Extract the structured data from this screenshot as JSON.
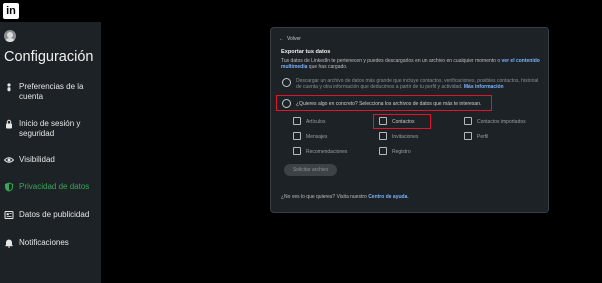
{
  "app": {
    "logo_text": "in"
  },
  "sidebar": {
    "title": "Configuración",
    "items": [
      {
        "label": "Preferencias de la cuenta",
        "icon": "person-icon",
        "active": false
      },
      {
        "label": "Inicio de sesión y seguridad",
        "icon": "lock-icon",
        "active": false
      },
      {
        "label": "Visibilidad",
        "icon": "eye-icon",
        "active": false
      },
      {
        "label": "Privacidad de datos",
        "icon": "shield-icon",
        "active": true
      },
      {
        "label": "Datos de publicidad",
        "icon": "newspaper-icon",
        "active": false
      },
      {
        "label": "Notificaciones",
        "icon": "bell-icon",
        "active": false
      }
    ]
  },
  "panel": {
    "back_label": "Volver",
    "heading": "Exportar tus datos",
    "description": "Tus datos de LinkedIn te pertenecen y puedes descargarlos en un archivo en cualquier momento o",
    "description_link": "ver el contenido multimedia",
    "description_tail": "que has cargado.",
    "option_all_text": "Descargar un archivo de datos más grande que incluye contactos, verificaciones, posibles contactos, historial de cuenta y otra información que deducimos a partir de tu perfil y actividad.",
    "option_all_link": "Más información",
    "option_specific_text": "¿Quieres algo en concreto? Selecciona los archivos de datos que más te interesan.",
    "checkboxes": [
      "Artículos",
      "Contactos",
      "Contactos importados",
      "Mensajes",
      "Invitaciones",
      "Perfil",
      "Recomendaciones",
      "Registro"
    ],
    "request_button": "Solicitar archivo",
    "help_text": "¿No ves lo que quieres? Visita nuestro",
    "help_link": "Centro de ayuda",
    "help_tail": ".",
    "colors": {
      "accent": "#3aa65a",
      "highlight": "#e0142d",
      "link": "#79b4ff"
    }
  }
}
